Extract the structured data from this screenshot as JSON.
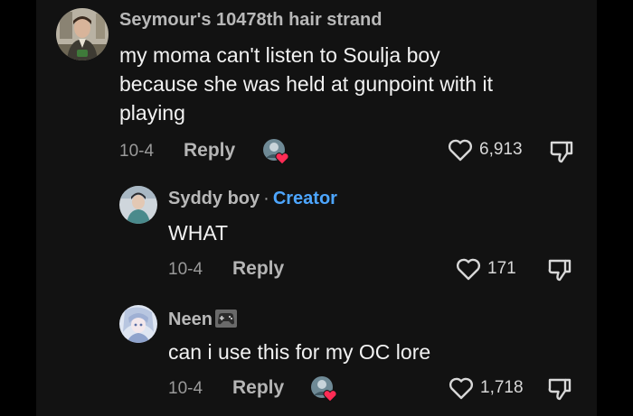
{
  "comments": [
    {
      "username": "Seymour's 10478th hair strand",
      "text": "my moma can't listen to Soulja boy\nbecause she was held at gunpoint with it\nplaying",
      "date": "10-4",
      "reply_label": "Reply",
      "likes": "6,913",
      "creator_liked": true
    },
    {
      "username": "Syddy boy",
      "separator": "·",
      "badge": "Creator",
      "text": "WHAT",
      "date": "10-4",
      "reply_label": "Reply",
      "likes": "171",
      "creator_liked": false
    },
    {
      "username": "Neen",
      "username_icon": "game-controller-icon",
      "text": "can i use this for my OC lore",
      "date": "10-4",
      "reply_label": "Reply",
      "likes": "1,718",
      "creator_liked": true
    }
  ],
  "colors": {
    "background": "#121212",
    "creator_badge": "#4da6ff",
    "heart_badge": "#fe2c55",
    "text_primary": "#f2f2f2",
    "text_muted": "#9a9a9a"
  },
  "icons": {
    "like": "heart-outline-icon",
    "dislike": "thumbs-down-icon",
    "creator_liked": "creator-liked-heart-icon"
  }
}
